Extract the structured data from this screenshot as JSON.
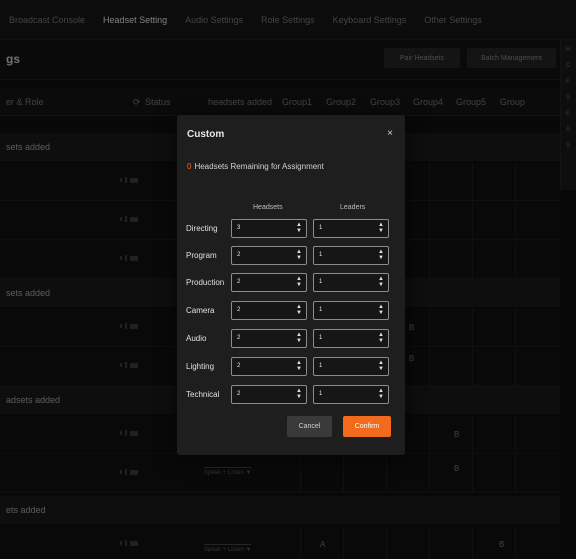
{
  "topnav": {
    "tabs": [
      "Broadcast Console",
      "Headset Setting",
      "Audio Settings",
      "Role Settings",
      "Keyboard Settings",
      "Other Settings"
    ],
    "active_index": 1
  },
  "header": {
    "title": "gs",
    "pair_label": "Pair Headsets",
    "batch_label": "Batch Management"
  },
  "right_panel": {
    "letters": [
      "H",
      "C",
      "F",
      "S",
      "E",
      "A",
      "S"
    ]
  },
  "columns": {
    "user_role": "er & Role",
    "status": "Status",
    "headsets_added": "headsets added",
    "groups": [
      "Group1",
      "Group2",
      "Group3",
      "Group4",
      "Group5",
      "Group"
    ]
  },
  "groups": [
    {
      "title": "sets added"
    },
    {
      "title": "sets added"
    },
    {
      "title": "adsets added"
    },
    {
      "title": "ets added"
    }
  ],
  "row_marks": {
    "b": "B",
    "a": "A",
    "speak_listen": "Speak + Listen ▼"
  },
  "modal": {
    "title": "Custom",
    "close": "×",
    "remaining_count": "0",
    "remaining_text": "Headsets Remaining for Assignment",
    "col_headsets": "Headsets",
    "col_leaders": "Leaders",
    "rows": [
      {
        "label": "Directing",
        "headsets": "3",
        "leaders": "1"
      },
      {
        "label": "Program",
        "headsets": "2",
        "leaders": "1"
      },
      {
        "label": "Production",
        "headsets": "2",
        "leaders": "1"
      },
      {
        "label": "Camera",
        "headsets": "2",
        "leaders": "1"
      },
      {
        "label": "Audio",
        "headsets": "2",
        "leaders": "1"
      },
      {
        "label": "Lighting",
        "headsets": "2",
        "leaders": "1"
      },
      {
        "label": "Technical",
        "headsets": "2",
        "leaders": "1"
      }
    ],
    "cancel_label": "Cancel",
    "confirm_label": "Confirm"
  },
  "colors": {
    "accent": "#f26b1d",
    "background": "#0f0f0f",
    "modal": "#1e1e1e"
  }
}
